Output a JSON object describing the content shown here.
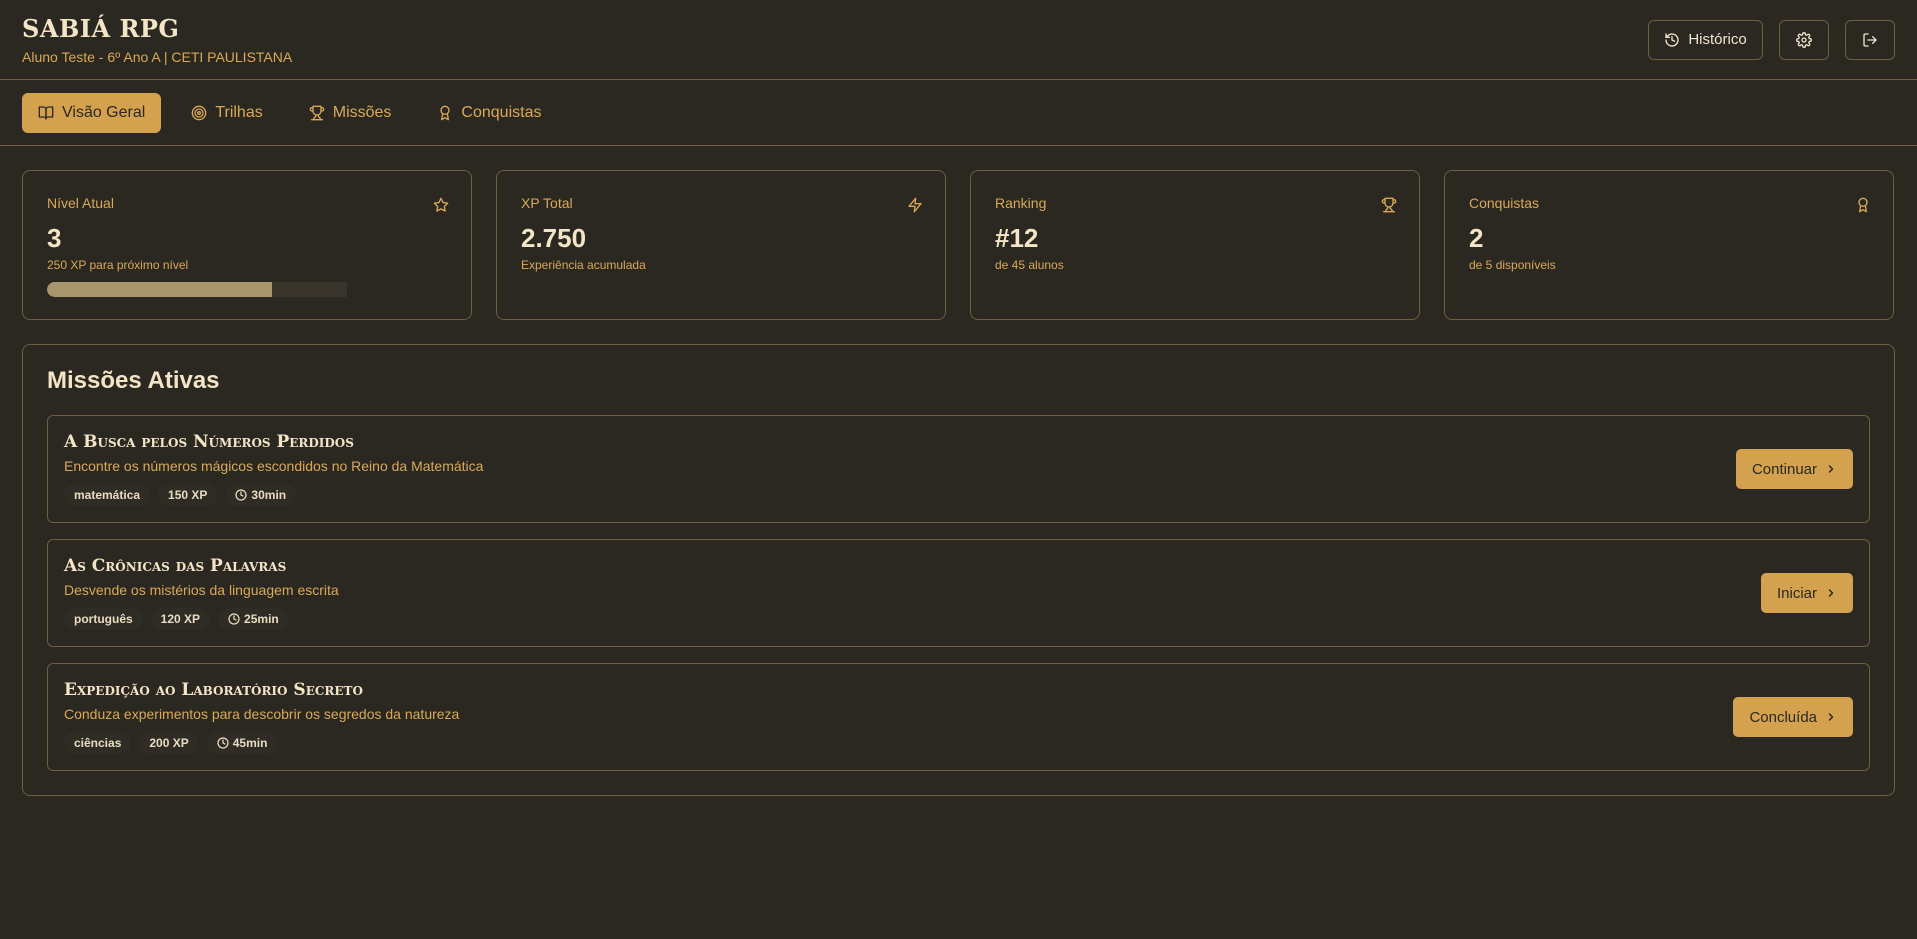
{
  "header": {
    "title": "SABIÁ RPG",
    "subtitle": "Aluno Teste - 6º Ano A | CETI PAULISTANA",
    "history_label": "Histórico"
  },
  "tabs": [
    {
      "label": "Visão Geral",
      "icon": "book-open-icon",
      "active": true
    },
    {
      "label": "Trilhas",
      "icon": "target-icon",
      "active": false
    },
    {
      "label": "Missões",
      "icon": "trophy-icon",
      "active": false
    },
    {
      "label": "Conquistas",
      "icon": "award-icon",
      "active": false
    }
  ],
  "stats": [
    {
      "label": "Nível Atual",
      "value": "3",
      "sub": "250 XP para próximo nível",
      "icon": "star-icon",
      "progress": 0.75
    },
    {
      "label": "XP Total",
      "value": "2.750",
      "sub": "Experiência acumulada",
      "icon": "zap-icon"
    },
    {
      "label": "Ranking",
      "value": "#12",
      "sub": "de 45 alunos",
      "icon": "trophy-icon"
    },
    {
      "label": "Conquistas",
      "value": "2",
      "sub": "de 5 disponíveis",
      "icon": "award-icon"
    }
  ],
  "missions": {
    "title": "Missões Ativas",
    "items": [
      {
        "name": "A Busca pelos Números Perdidos",
        "description": "Encontre os números mágicos escondidos no Reino da Matemática",
        "subject": "matemática",
        "xp": "150 XP",
        "time": "30min",
        "action": "Continuar"
      },
      {
        "name": "As Crônicas das Palavras",
        "description": "Desvende os mistérios da linguagem escrita",
        "subject": "português",
        "xp": "120 XP",
        "time": "25min",
        "action": "Iniciar"
      },
      {
        "name": "Expedição ao Laboratório Secreto",
        "description": "Conduza experimentos para descobrir os segredos da natureza",
        "subject": "ciências",
        "xp": "200 XP",
        "time": "45min",
        "action": "Concluída"
      }
    ]
  },
  "colors": {
    "background": "#2b2822",
    "accent": "#d4a14e",
    "accent_text": "#d9a957",
    "border": "#6d5f3f",
    "progress_fill": "#a8956c"
  }
}
